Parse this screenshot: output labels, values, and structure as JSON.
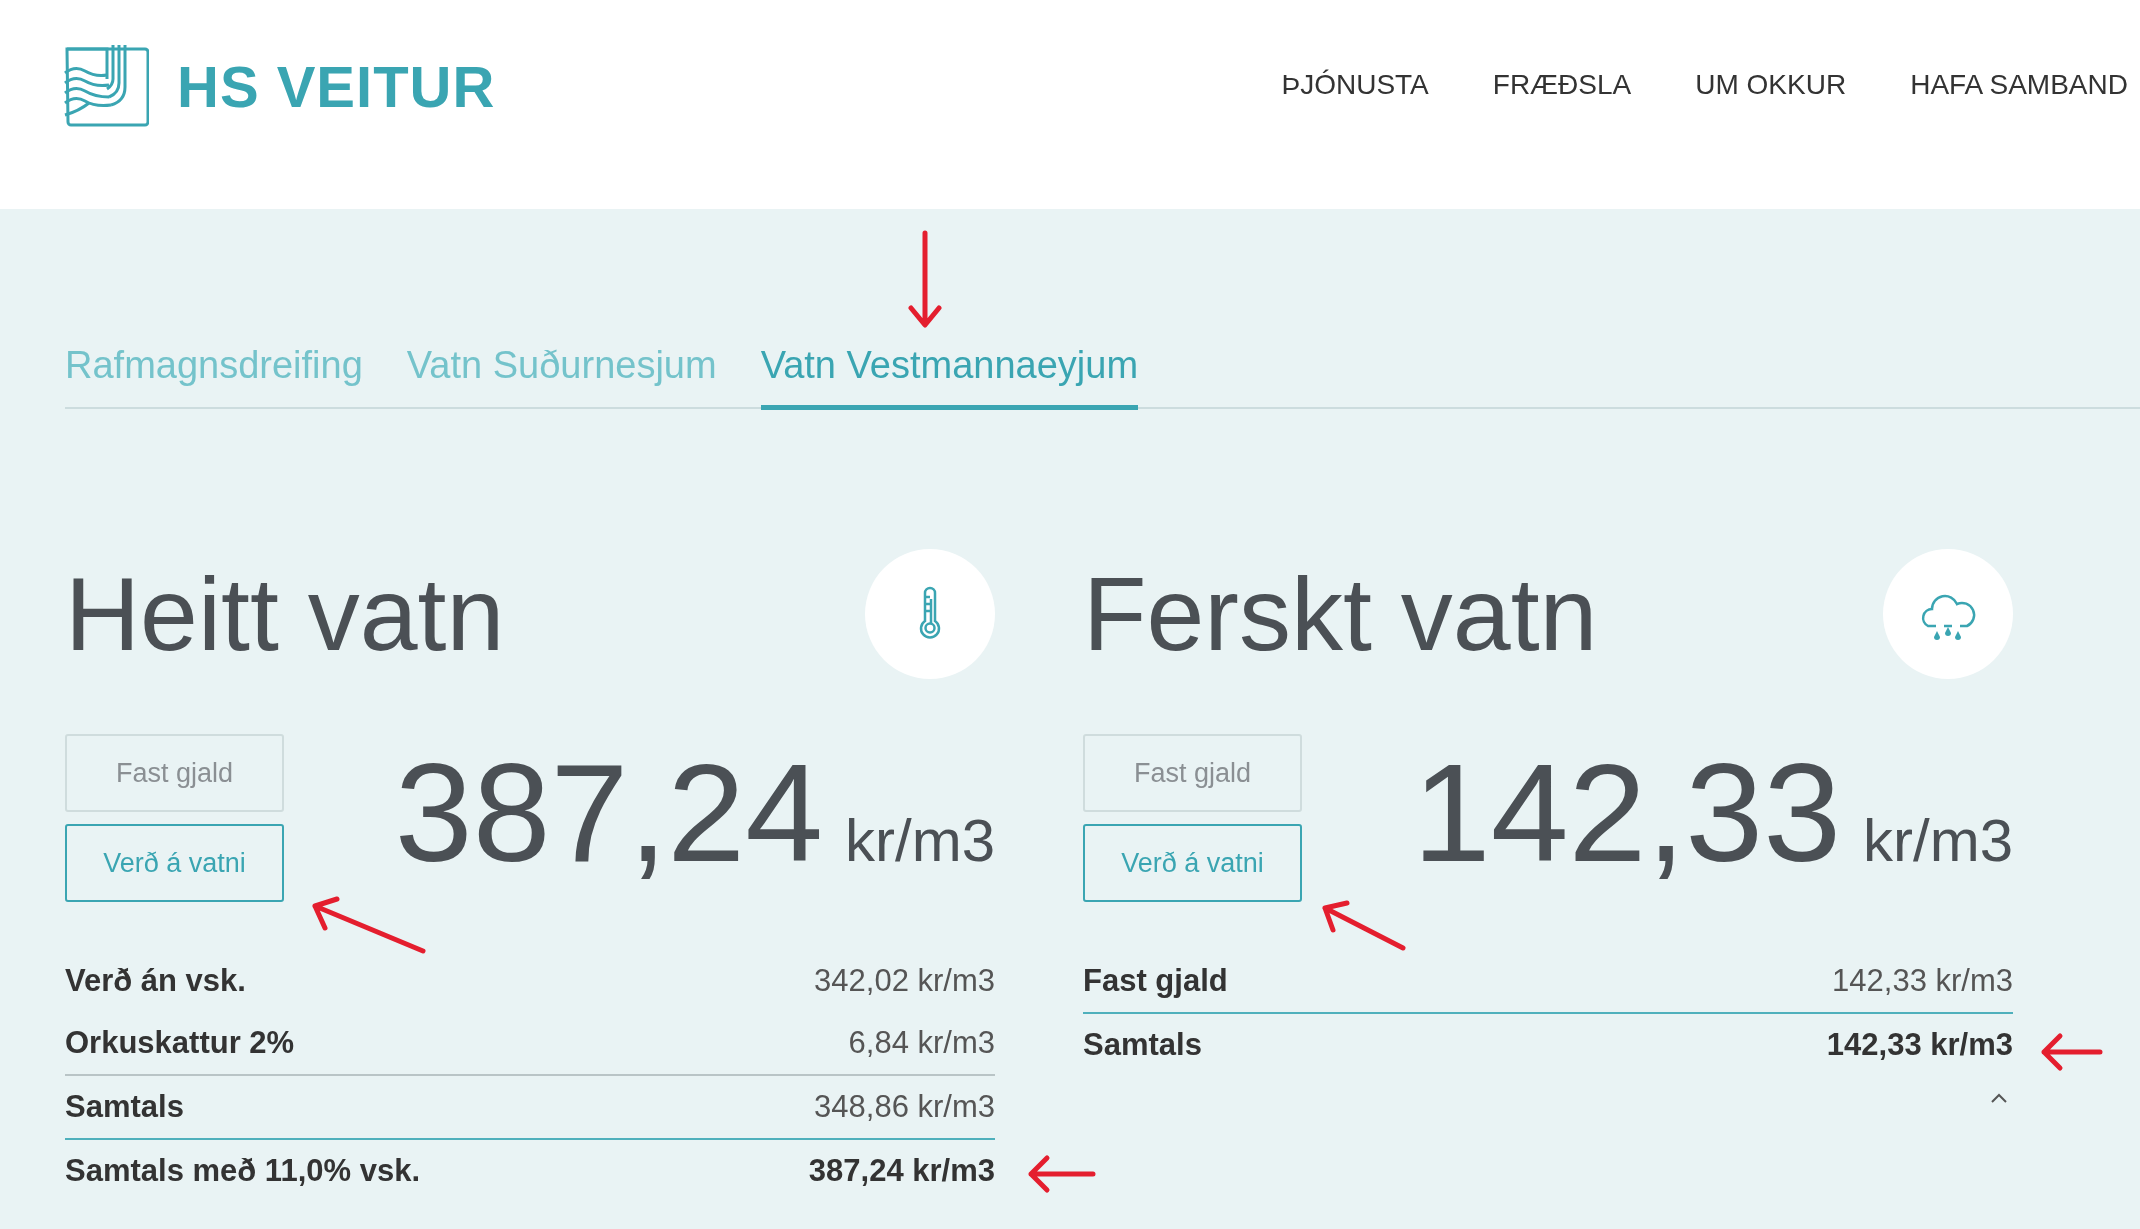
{
  "header": {
    "logo_text": "HS VEITUR",
    "nav": [
      "ÞJÓNUSTA",
      "FRÆÐSLA",
      "UM OKKUR",
      "HAFA SAMBAND"
    ]
  },
  "tabs": [
    {
      "label": "Rafmagnsdreifing",
      "selected": false
    },
    {
      "label": "Vatn Suðurnesjum",
      "selected": false
    },
    {
      "label": "Vatn Vestmannaeyjum",
      "selected": true
    }
  ],
  "cards": [
    {
      "title": "Heitt vatn",
      "kind": "thermometer",
      "buttons": [
        {
          "label": "Fast gjald",
          "selected": false
        },
        {
          "label": "Verð á vatni",
          "selected": true
        }
      ],
      "price": "387,24",
      "unit": "kr/m3",
      "collapse": false,
      "rows": [
        {
          "kind": "line",
          "label": "Verð án vsk.",
          "value": "342,02 kr/m3"
        },
        {
          "kind": "line",
          "label": "Orkuskattur 2%",
          "value": "6,84 kr/m3"
        },
        {
          "kind": "subtotal",
          "label": "Samtals",
          "value": "348,86 kr/m3"
        },
        {
          "kind": "total",
          "label": "Samtals með 11,0% vsk.",
          "value": "387,24 kr/m3"
        }
      ]
    },
    {
      "title": "Ferskt vatn",
      "kind": "rain",
      "buttons": [
        {
          "label": "Fast gjald",
          "selected": false
        },
        {
          "label": "Verð á vatni",
          "selected": true
        }
      ],
      "price": "142,33",
      "unit": "kr/m3",
      "collapse": true,
      "rows": [
        {
          "kind": "line",
          "label": "Fast gjald",
          "value": "142,33 kr/m3"
        },
        {
          "kind": "total",
          "label": "Samtals",
          "value": "142,33 kr/m3"
        }
      ]
    }
  ]
}
